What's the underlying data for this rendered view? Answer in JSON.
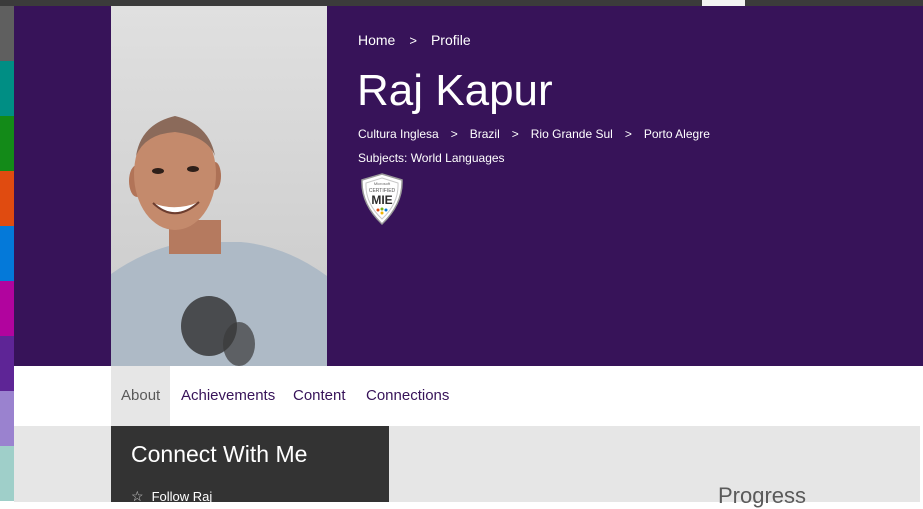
{
  "colors": {
    "hero_bg": "#371359",
    "tab_text": "#371359",
    "connect_bg": "#333333",
    "content_bg": "#e6e6e6",
    "strip": [
      "#5f5f5f",
      "#008e84",
      "#138a18",
      "#e04b10",
      "#0479d9",
      "#b1049e",
      "#5e2596",
      "#9a82cf",
      "#9fcfc9"
    ]
  },
  "breadcrumb": {
    "items": [
      "Home",
      "Profile"
    ],
    "separator": ">"
  },
  "profile": {
    "name": "Raj Kapur",
    "location": [
      "Cultura Inglesa",
      "Brazil",
      "Rio Grande Sul",
      "Porto Alegre"
    ],
    "subjects": "Subjects: World Languages",
    "badge": {
      "icon": "certified-mie-badge",
      "top_text": "Microsoft",
      "mid_text": "CERTIFIED",
      "main_text": "MIE"
    }
  },
  "tabs": [
    {
      "label": "About",
      "active": true
    },
    {
      "label": "Achievements",
      "active": false
    },
    {
      "label": "Content",
      "active": false
    },
    {
      "label": "Connections",
      "active": false
    }
  ],
  "connect": {
    "title": "Connect With Me",
    "follow_icon": "star-icon",
    "follow_label": "Follow Raj"
  },
  "progress": {
    "title": "Progress"
  }
}
